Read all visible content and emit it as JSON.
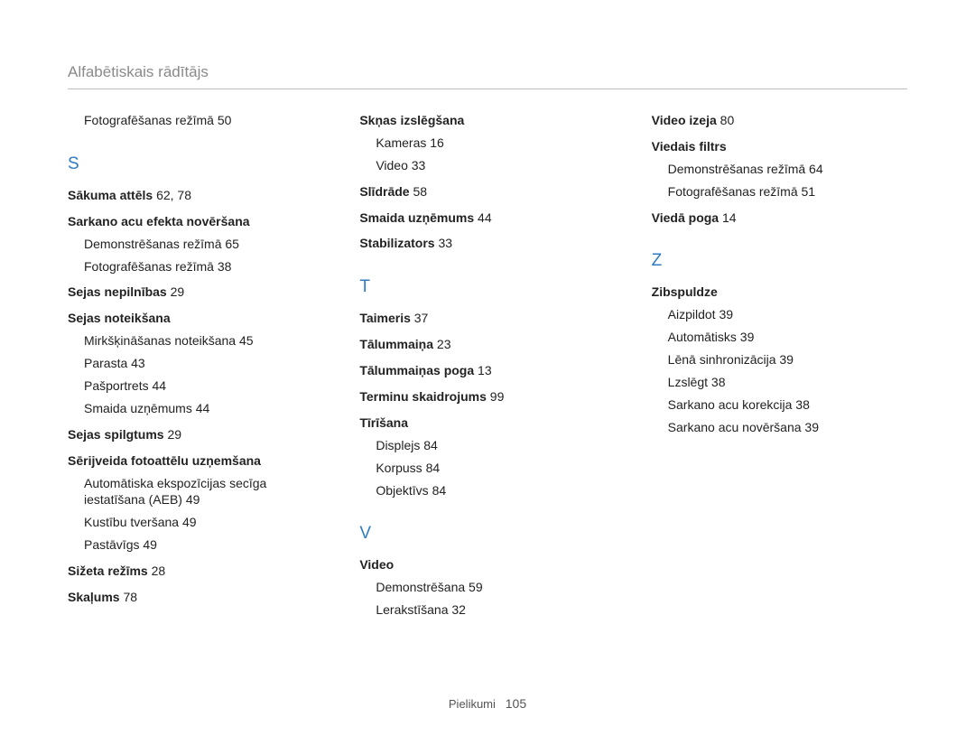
{
  "header": "Alfabētiskais rādītājs",
  "footer_label": "Pielikumi",
  "footer_page": "105",
  "col1": {
    "top": "Fotografēšanas režīmā  50",
    "letter": "S",
    "e1": {
      "label": "Sākuma attēls",
      "pages": "62, 78"
    },
    "e2": {
      "label": "Sarkano acu efekta novēršana"
    },
    "e2s1": "Demonstrēšanas režīmā  65",
    "e2s2": "Fotografēšanas režīmā  38",
    "e3": {
      "label": "Sejas nepilnības",
      "pages": "29"
    },
    "e4": {
      "label": "Sejas noteikšana"
    },
    "e4s1": "Mirkšķināšanas noteikšana  45",
    "e4s2": "Parasta  43",
    "e4s3": "Pašportrets  44",
    "e4s4": "Smaida uzņēmums  44",
    "e5": {
      "label": "Sejas spilgtums",
      "pages": "29"
    },
    "e6": {
      "label": "Sērijveida fotoattēlu uzņemšana"
    },
    "e6s1": "Automātiska ekspozīcijas secīga iestatīšana (AEB)  49",
    "e6s2": "Kustību tveršana  49",
    "e6s3": "Pastāvīgs  49",
    "e7": {
      "label": "Sižeta režīms",
      "pages": "28"
    },
    "e8": {
      "label": "Skaļums",
      "pages": "78"
    }
  },
  "col2": {
    "e1": {
      "label": "Skņas izslēgšana"
    },
    "e1s1": "Kameras  16",
    "e1s2": "Video  33",
    "e2": {
      "label": "Slīdrāde",
      "pages": "58"
    },
    "e3": {
      "label": "Smaida uzņēmums",
      "pages": "44"
    },
    "e4": {
      "label": "Stabilizators",
      "pages": "33"
    },
    "letterT": "T",
    "t1": {
      "label": "Taimeris",
      "pages": "37"
    },
    "t2": {
      "label": "Tālummaiņa",
      "pages": "23"
    },
    "t3": {
      "label": "Tālummaiņas poga",
      "pages": "13"
    },
    "t4": {
      "label": "Terminu skaidrojums",
      "pages": "99"
    },
    "t5": {
      "label": "Tīrīšana"
    },
    "t5s1": "Displejs  84",
    "t5s2": "Korpuss  84",
    "t5s3": "Objektīvs  84",
    "letterV": "V",
    "v1": {
      "label": "Video"
    },
    "v1s1": "Demonstrēšana  59",
    "v1s2": "Lerakstīšana  32"
  },
  "col3": {
    "e1": {
      "label": "Video izeja",
      "pages": "80"
    },
    "e2": {
      "label": "Viedais filtrs"
    },
    "e2s1": "Demonstrēšanas režīmā  64",
    "e2s2": "Fotografēšanas režīmā  51",
    "e3": {
      "label": "Viedā poga",
      "pages": "14"
    },
    "letterZ": "Z",
    "z1": {
      "label": "Zibspuldze"
    },
    "z1s1": "Aizpildot  39",
    "z1s2": "Automātisks  39",
    "z1s3": "Lēnā sinhronizācija  39",
    "z1s4": "Lzslēgt  38",
    "z1s5": "Sarkano acu korekcija  38",
    "z1s6": "Sarkano acu novēršana  39"
  }
}
